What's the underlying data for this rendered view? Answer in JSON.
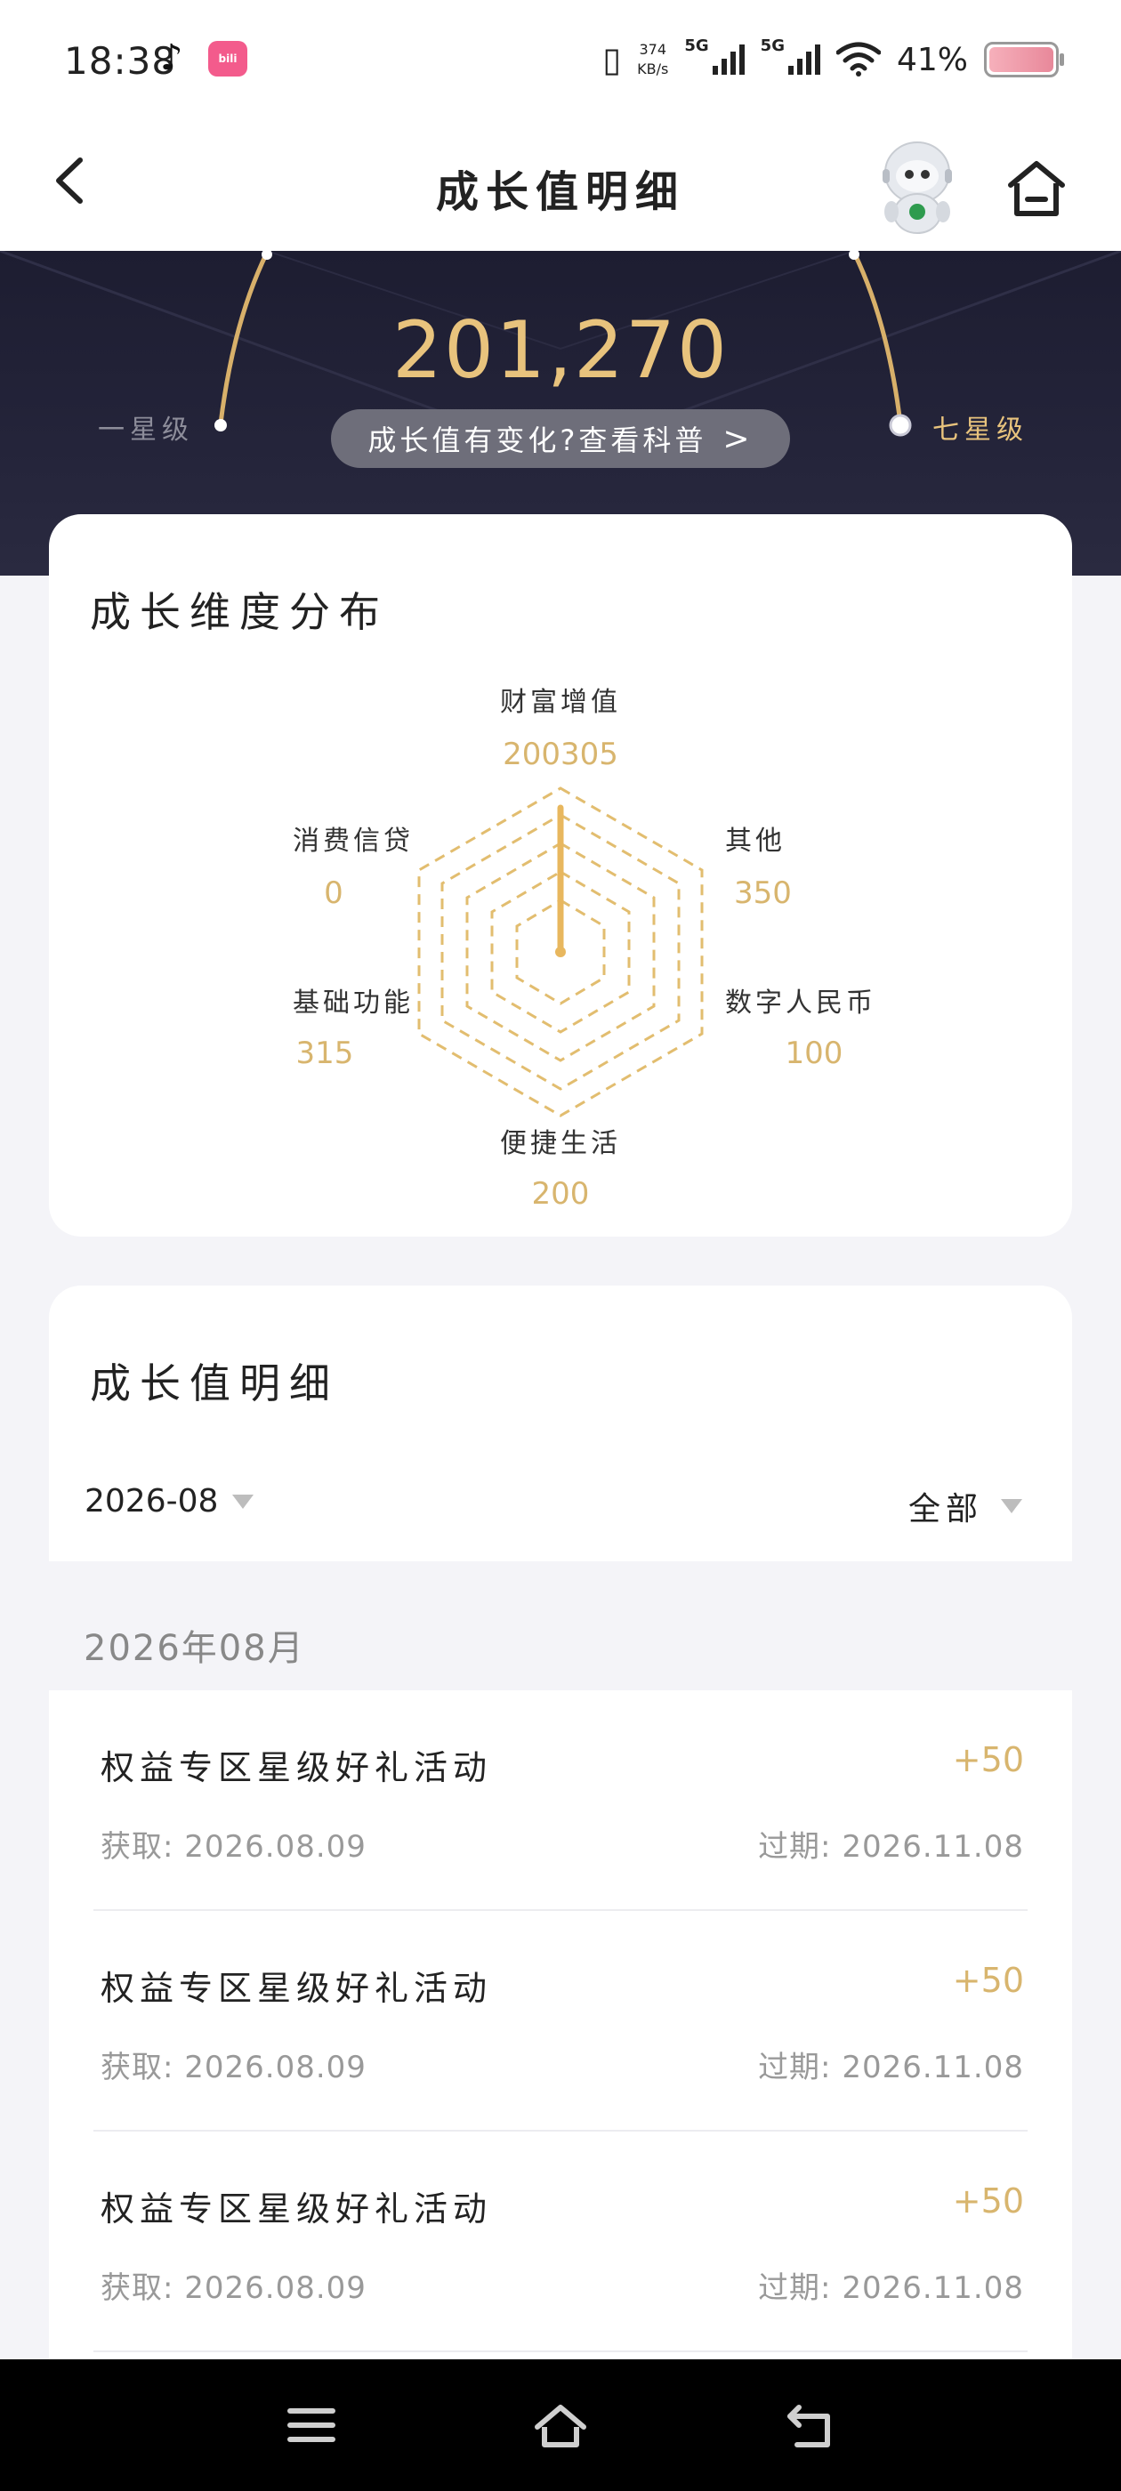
{
  "status_bar": {
    "time": "18:38",
    "app_icons": [
      "tiktok-icon",
      "bilibili-icon"
    ],
    "speed_value": "374",
    "speed_unit": "KB/s",
    "network_1": "5G",
    "network_2": "5G",
    "battery_percent": "41%"
  },
  "nav": {
    "title": "成长值明细"
  },
  "hero": {
    "growth_value": "201,270",
    "info_pill": "成长值有变化?查看科普",
    "left_level": "一星级",
    "right_level": "七星级",
    "colors": {
      "gold": "#e8c37d",
      "bg": "#1d1d31"
    }
  },
  "radar": {
    "title": "成长维度分布",
    "axes": [
      {
        "label": "财富增值",
        "value": "200305"
      },
      {
        "label": "其他",
        "value": "350"
      },
      {
        "label": "数字人民币",
        "value": "100"
      },
      {
        "label": "便捷生活",
        "value": "200"
      },
      {
        "label": "基础功能",
        "value": "315"
      },
      {
        "label": "消费信贷",
        "value": "0"
      }
    ]
  },
  "detail": {
    "title": "成长值明细",
    "filter_month": "2026-08",
    "filter_type": "全部",
    "month_header": "2026年08月",
    "items": [
      {
        "name": "权益专区星级好礼活动",
        "points": "+50",
        "got": "获取: 2026.08.09",
        "expire": "过期: 2026.11.08"
      },
      {
        "name": "权益专区星级好礼活动",
        "points": "+50",
        "got": "获取: 2026.08.09",
        "expire": "过期: 2026.11.08"
      },
      {
        "name": "权益专区星级好礼活动",
        "points": "+50",
        "got": "获取: 2026.08.09",
        "expire": "过期: 2026.11.08"
      }
    ]
  }
}
